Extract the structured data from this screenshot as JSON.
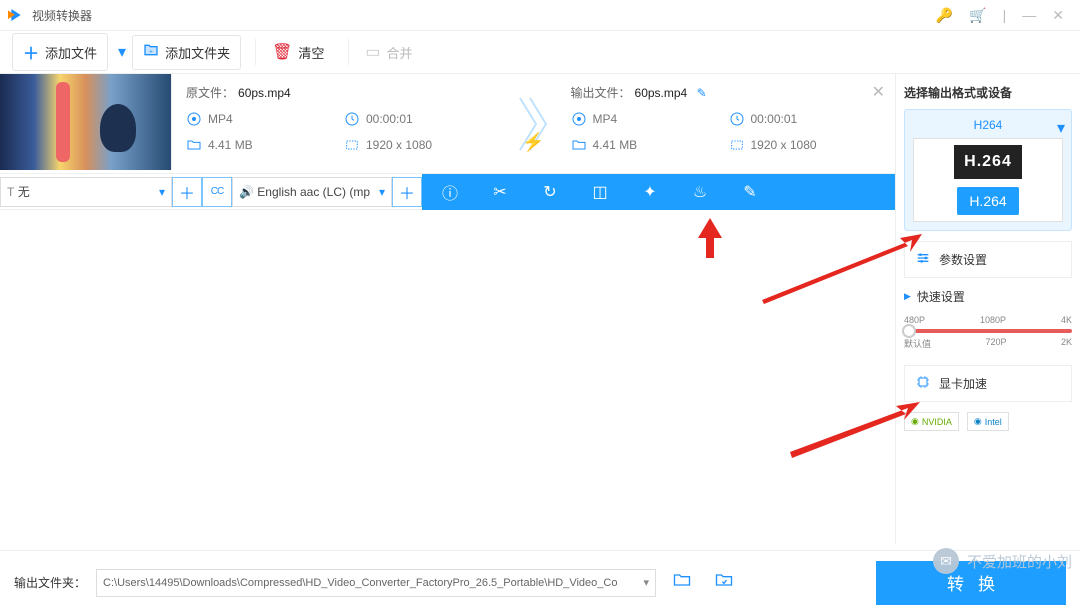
{
  "colors": {
    "accent": "#1e9fff",
    "link": "#1e90ff",
    "danger": "#d23",
    "arrow": "#e4271f"
  },
  "titlebar": {
    "title": "视频转换器"
  },
  "toolbar": {
    "add_file": "添加文件",
    "add_folder": "添加文件夹",
    "clear": "清空",
    "merge": "合并"
  },
  "file": {
    "source_label": "原文件：",
    "output_label": "输出文件：",
    "source_name": "60ps.mp4",
    "output_name": "60ps.mp4",
    "source": {
      "format": "MP4",
      "duration": "00:00:01",
      "size": "4.41 MB",
      "resolution": "1920 x 1080"
    },
    "output": {
      "format": "MP4",
      "duration": "00:00:01",
      "size": "4.41 MB",
      "resolution": "1920 x 1080"
    }
  },
  "subtitles": {
    "track_label": "无",
    "audio_label": "English aac (LC) (mp"
  },
  "right": {
    "title": "选择输出格式或设备",
    "format_tab": "H264",
    "badge_black": "H.264",
    "badge_blue": "H.264",
    "param_btn": "参数设置",
    "quick_title": "快速设置",
    "slider_top": [
      "480P",
      "1080P",
      "4K"
    ],
    "slider_bot": [
      "默认值",
      "720P",
      "2K"
    ],
    "gpu_btn": "显卡加速",
    "gpu_vendors": [
      "NVIDIA",
      "Intel"
    ]
  },
  "bottom": {
    "output_folder_label": "输出文件夹：",
    "path": "C:\\Users\\14495\\Downloads\\Compressed\\HD_Video_Converter_FactoryPro_26.5_Portable\\HD_Video_Co",
    "convert": "转换"
  },
  "watermark": "不爱加班的小刘"
}
